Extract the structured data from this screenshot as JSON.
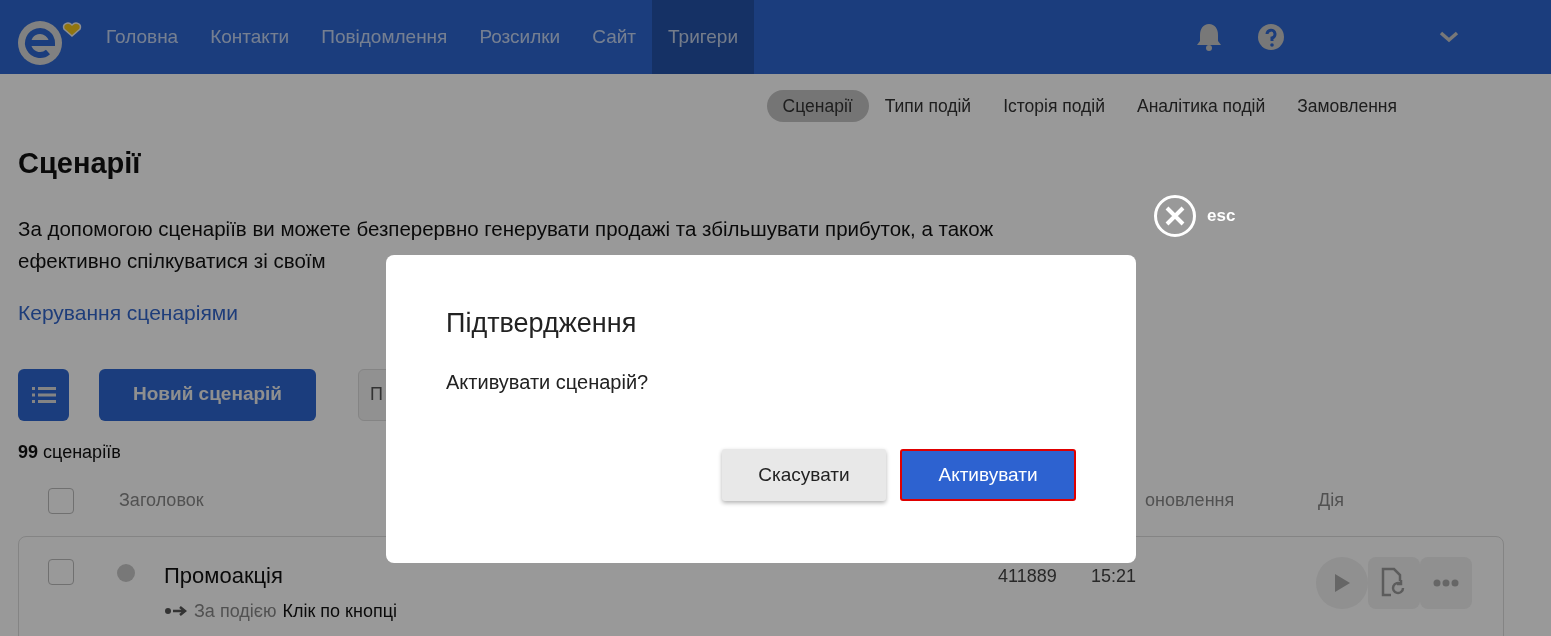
{
  "navbar": {
    "items": [
      {
        "label": "Головна",
        "selected": false
      },
      {
        "label": "Контакти",
        "selected": false
      },
      {
        "label": "Повідомлення",
        "selected": false
      },
      {
        "label": "Розсилки",
        "selected": false
      },
      {
        "label": "Сайт",
        "selected": false
      },
      {
        "label": "Тригери",
        "selected": true
      }
    ]
  },
  "subnav": [
    {
      "label": "Сценарії",
      "selected": true
    },
    {
      "label": "Типи подій",
      "selected": false
    },
    {
      "label": "Історія подій",
      "selected": false
    },
    {
      "label": "Аналітика подій",
      "selected": false
    },
    {
      "label": "Замовлення",
      "selected": false
    }
  ],
  "page": {
    "title": "Сценарії",
    "description_lines": [
      "За допомогою сценаріїв ви можете безперервно генерувати продажі та збільшувати прибуток, а також",
      "ефективно спілкуватися зі своїм"
    ],
    "link": "Керування сценаріями"
  },
  "toolbar": {
    "new_button": "Новий сценарій",
    "partial_button": "П"
  },
  "count": {
    "number": "99",
    "label": "сценаріїв"
  },
  "table": {
    "select_all_checked": false,
    "columns": [
      "Заголовок",
      "оновлення",
      "Дія"
    ],
    "rows": [
      {
        "checked": false,
        "active": false,
        "title": "Промоакція",
        "trigger_label": "За подією",
        "trigger_value": "Клік по кнопці",
        "column_3": "411889",
        "time": "15:21"
      }
    ]
  },
  "modal": {
    "close_hint": "esc",
    "title": "Підтвердження",
    "message": "Активувати сценарій?",
    "buttons": [
      {
        "label": "Скасувати",
        "kind": "secondary",
        "focused": false
      },
      {
        "label": "Активувати",
        "kind": "primary",
        "focused": true
      }
    ]
  }
}
